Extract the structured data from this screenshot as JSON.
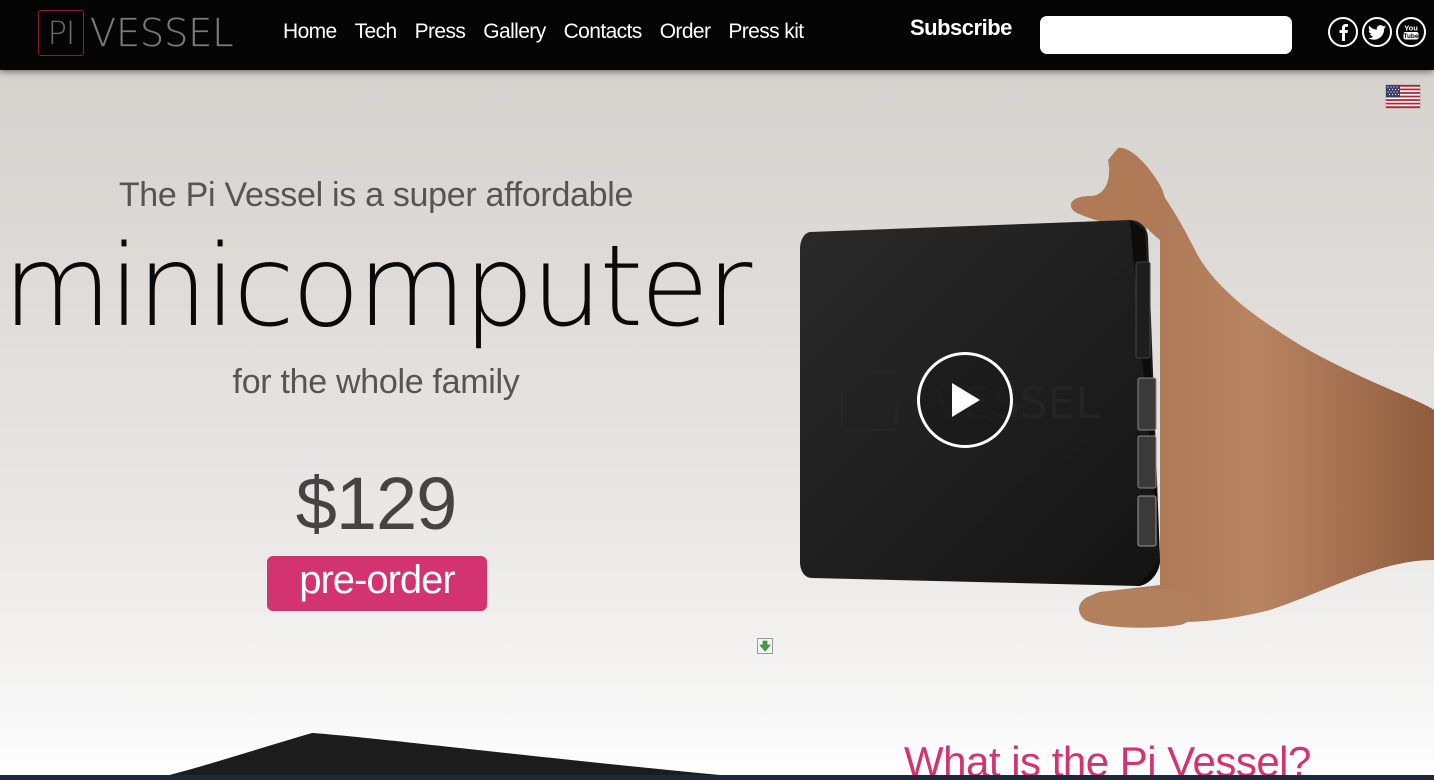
{
  "header": {
    "logo_letters": "PI",
    "logo_word": "VESSEL",
    "nav": [
      "Home",
      "Tech",
      "Press",
      "Gallery",
      "Contacts",
      "Order",
      "Press kit"
    ],
    "subscribe_label": "Subscribe",
    "subscribe_value": "",
    "social": [
      "facebook-icon",
      "twitter-icon",
      "youtube-icon"
    ]
  },
  "hero": {
    "tagline_top": "The Pi Vessel is a super affordable",
    "headline": "minicomputer",
    "tagline_bottom": "for the whole family",
    "price": "$129",
    "cta": "pre-order",
    "language_flag": "us-flag-icon",
    "video": "play-icon",
    "scroll": "download-arrow-icon"
  },
  "section": {
    "title": "What is the Pi Vessel?"
  },
  "colors": {
    "accent": "#d3336e",
    "header_bg": "#050505",
    "logo_border": "#8e1d34"
  }
}
